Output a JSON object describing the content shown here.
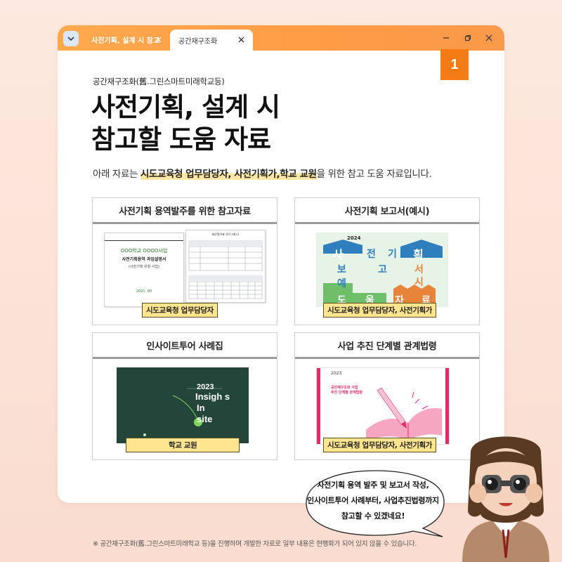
{
  "tabs": [
    {
      "label": "사전기획, 설계 시 참고",
      "active": false
    },
    {
      "label": "공간재구조화",
      "active": true
    }
  ],
  "badge_number": "1",
  "eyebrow": "공간재구조화(舊.그린스마트미래학교등)",
  "title_line1": "사전기획, 설계 시",
  "title_line2": "참고할 도움 자료",
  "description": {
    "prefix": "아래 자료는 ",
    "highlight": "시도교육청 업무담당자, 사전기획가,학교 교원",
    "suffix": "을 위한 참고 도움 자료입니다."
  },
  "cards": [
    {
      "title": "사전기획 용역발주를 위한 참고자료",
      "tag": "시도교육청 업무담당자",
      "doc_lines": [
        "OOO학교 OOOO사업",
        "사전기획용역 과업설명서",
        "(사전기획 유형 사업)",
        "2021. 00"
      ],
      "table_title": "제안평가표 양식 (예시)"
    },
    {
      "title": "사전기획 보고서(예시)",
      "tag": "시도교육청 업무담당자, 사전기획가",
      "year": "2024",
      "grid_text": [
        "사",
        "전",
        "기",
        "획",
        "보",
        "고",
        "서",
        "예",
        "시",
        "도",
        "움",
        "자",
        "료"
      ]
    },
    {
      "title": "인사이트투어 사례집",
      "tag": "학교 교원",
      "cover_year": "2023",
      "cover_lines": [
        "Insigh s",
        "In",
        "site"
      ]
    },
    {
      "title": "사업 추진 단계별 관계법령",
      "tag": "시도교육청 업무담당자, 사전기획가",
      "cover_year": "2023",
      "cover_lines": [
        "공간재구조화 사업",
        "추진 단계별 관계법령"
      ]
    }
  ],
  "bubble": {
    "line1": "사전기획 용역 발주 및 보고서 작성,",
    "line2": "인사이트투어 사례부터, 사업추진법령까지",
    "line3": "참고할 수 있겠네요!"
  },
  "footnote": "※ 공간재구조화(舊.그린스마트미래학교 등)을 진행하며 개발한 자료로 일부 내용은 현행화가 되어 있지 않을 수 있습니다.",
  "colors": {
    "accent_orange": "#f57c14",
    "titlebar": "#ff9b45",
    "highlight": "#ffe7a3",
    "tag_fill": "#ffe58f",
    "report_blue": "#2f7fbf",
    "report_green": "#6fbf6a",
    "report_orange": "#e8833a",
    "insight_green": "#24463a",
    "law_pink": "#e8286b"
  },
  "icons": [
    "chevron-down-icon",
    "close-icon",
    "minimize-icon",
    "restore-icon",
    "close-window-icon"
  ]
}
